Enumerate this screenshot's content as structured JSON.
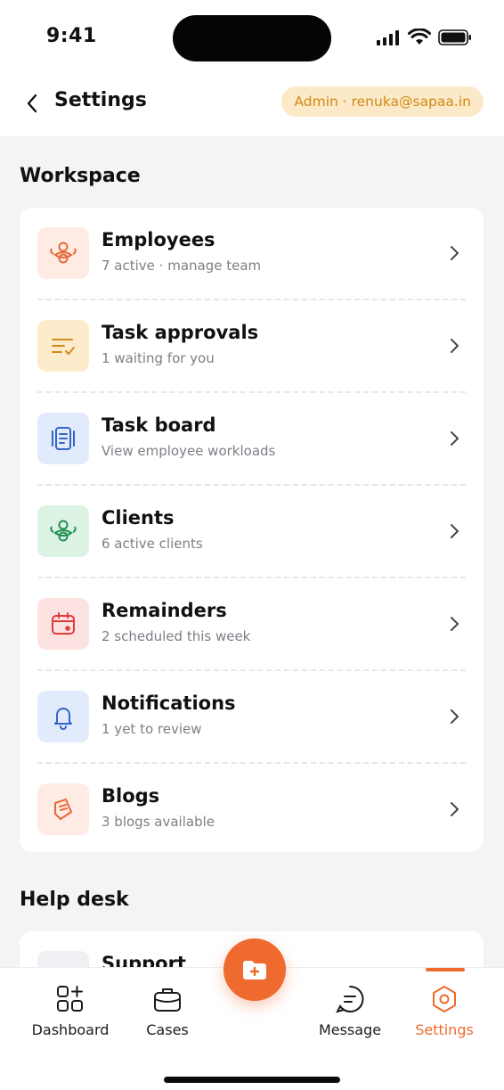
{
  "status_bar": {
    "time": "9:41"
  },
  "header": {
    "title": "Settings",
    "admin_badge": "Admin · renuka@sapaa.in"
  },
  "colors": {
    "accent": "#ee6a2e",
    "badge_bg": "#fce9c7",
    "badge_text": "#cf8a16"
  },
  "workspace": {
    "title": "Workspace",
    "items": [
      {
        "title": "Employees",
        "subtitle": "7 active · manage team",
        "icon": "users-icon"
      },
      {
        "title": "Task approvals",
        "subtitle": "1 waiting for you",
        "icon": "checklist-icon"
      },
      {
        "title": "Task board",
        "subtitle": "View employee workloads",
        "icon": "board-icon"
      },
      {
        "title": "Clients",
        "subtitle": "6 active clients",
        "icon": "clients-icon"
      },
      {
        "title": "Remainders",
        "subtitle": "2 scheduled this week",
        "icon": "calendar-icon"
      },
      {
        "title": "Notifications",
        "subtitle": "1 yet to review",
        "icon": "bell-icon"
      },
      {
        "title": "Blogs",
        "subtitle": "3 blogs available",
        "icon": "blog-icon"
      }
    ]
  },
  "help_desk": {
    "title": "Help desk",
    "items": [
      {
        "title": "Support",
        "icon": "support-icon"
      }
    ]
  },
  "bottom_nav": {
    "items": [
      {
        "label": "Dashboard",
        "icon": "dashboard-icon"
      },
      {
        "label": "Cases",
        "icon": "briefcase-icon"
      },
      {
        "label": "Message",
        "icon": "message-icon"
      },
      {
        "label": "Settings",
        "icon": "settings-icon",
        "active": true
      }
    ],
    "fab_icon": "add-folder-icon"
  }
}
